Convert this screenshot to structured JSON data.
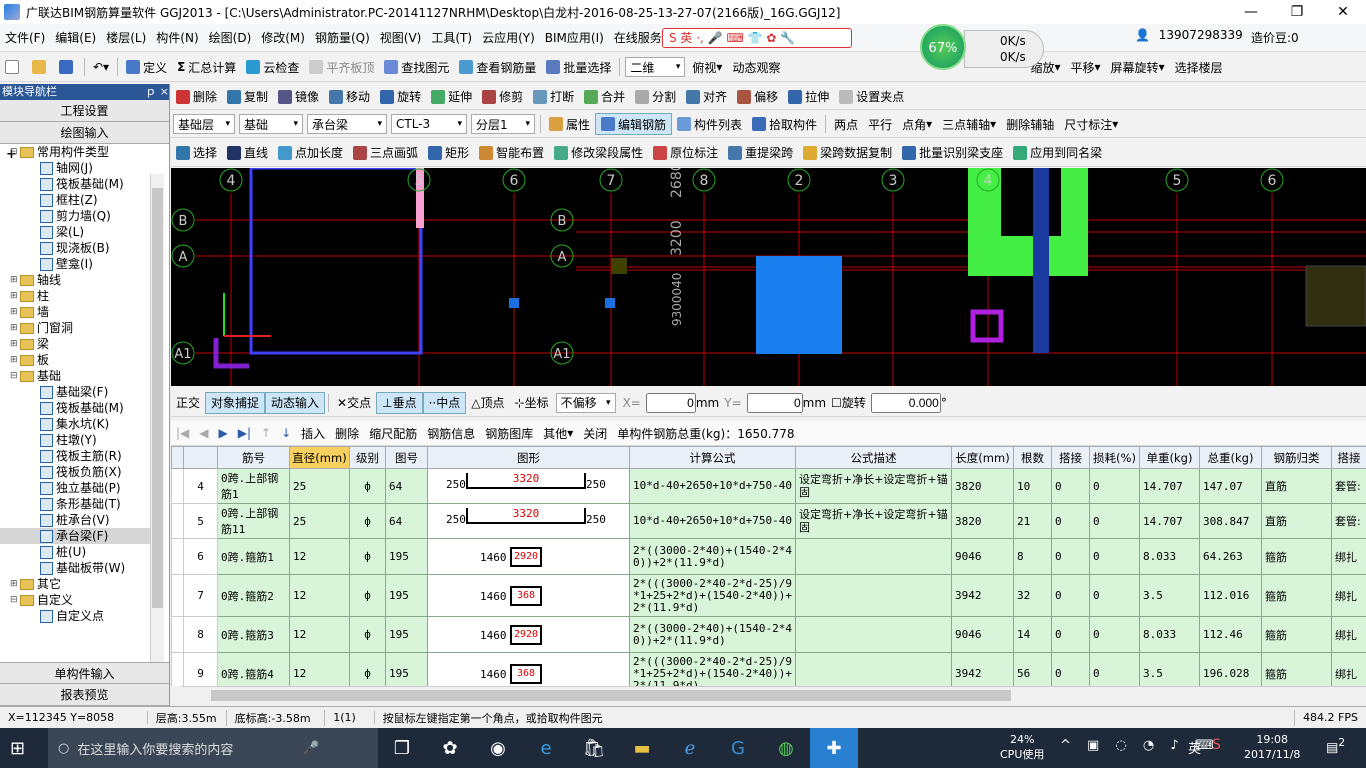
{
  "window": {
    "title": "广联达BIM钢筋算量软件 GGJ2013 - [C:\\Users\\Administrator.PC-20141127NRHM\\Desktop\\白龙村-2016-08-25-13-27-07(2166版)_16G.GGJ12]"
  },
  "menu": [
    "文件(F)",
    "编辑(E)",
    "楼层(L)",
    "构件(N)",
    "绘图(D)",
    "修改(M)",
    "钢筋量(Q)",
    "视图(V)",
    "工具(T)",
    "云应用(Y)",
    "BIM应用(I)",
    "在线服务(S)"
  ],
  "menu_right": {
    "phone": "13907298339",
    "coins": "造价豆:0"
  },
  "net_widget": {
    "percent": "67%",
    "up": "0K/s",
    "down": "0K/s"
  },
  "toolbar1": [
    "定义",
    "汇总计算",
    "云检查",
    "平齐板顶",
    "查找图元",
    "查看钢筋量",
    "批量选择"
  ],
  "toolbar1_right": [
    "二维",
    "俯视",
    "动态观察",
    "缩放",
    "平移",
    "屏幕旋转",
    "选择楼层"
  ],
  "toolbar2": [
    "删除",
    "复制",
    "镜像",
    "移动",
    "旋转",
    "延伸",
    "修剪",
    "打断",
    "合并",
    "分割",
    "对齐",
    "偏移",
    "拉伸",
    "设置夹点"
  ],
  "toolbar3": {
    "floor": "基础层",
    "cat": "基础",
    "type": "承台梁",
    "name": "CTL-3",
    "layer": "分层1",
    "buttons": [
      "属性",
      "编辑钢筋",
      "构件列表",
      "拾取构件",
      "两点",
      "平行",
      "点角",
      "三点辅轴",
      "删除辅轴",
      "尺寸标注"
    ]
  },
  "toolbar4": [
    "选择",
    "直线",
    "点加长度",
    "三点画弧",
    "矩形",
    "智能布置",
    "修改梁段属性",
    "原位标注",
    "重提梁跨",
    "梁跨数据复制",
    "批量识别梁支座",
    "应用到同名梁"
  ],
  "left_panel": {
    "header": "模块导航栏",
    "pin": "ｐ ×",
    "btn_project": "工程设置",
    "btn_draw": "绘图输入",
    "btn_single": "单构件输入",
    "btn_report": "报表预览"
  },
  "tree": [
    {
      "t": "常用构件类型",
      "lvl": 0,
      "ex": "⊟",
      "folder": true
    },
    {
      "t": "轴网(J)",
      "lvl": 2
    },
    {
      "t": "筏板基础(M)",
      "lvl": 2
    },
    {
      "t": "框柱(Z)",
      "lvl": 2
    },
    {
      "t": "剪力墙(Q)",
      "lvl": 2
    },
    {
      "t": "梁(L)",
      "lvl": 2
    },
    {
      "t": "现浇板(B)",
      "lvl": 2
    },
    {
      "t": "壁龛(I)",
      "lvl": 2
    },
    {
      "t": "轴线",
      "lvl": 0,
      "ex": "⊞",
      "folder": true
    },
    {
      "t": "柱",
      "lvl": 0,
      "ex": "⊞",
      "folder": true
    },
    {
      "t": "墙",
      "lvl": 0,
      "ex": "⊞",
      "folder": true
    },
    {
      "t": "门窗洞",
      "lvl": 0,
      "ex": "⊞",
      "folder": true
    },
    {
      "t": "梁",
      "lvl": 0,
      "ex": "⊞",
      "folder": true
    },
    {
      "t": "板",
      "lvl": 0,
      "ex": "⊞",
      "folder": true
    },
    {
      "t": "基础",
      "lvl": 0,
      "ex": "⊟",
      "folder": true
    },
    {
      "t": "基础梁(F)",
      "lvl": 2
    },
    {
      "t": "筏板基础(M)",
      "lvl": 2
    },
    {
      "t": "集水坑(K)",
      "lvl": 2
    },
    {
      "t": "柱墩(Y)",
      "lvl": 2
    },
    {
      "t": "筏板主筋(R)",
      "lvl": 2
    },
    {
      "t": "筏板负筋(X)",
      "lvl": 2
    },
    {
      "t": "独立基础(P)",
      "lvl": 2
    },
    {
      "t": "条形基础(T)",
      "lvl": 2
    },
    {
      "t": "桩承台(V)",
      "lvl": 2
    },
    {
      "t": "承台梁(F)",
      "lvl": 2,
      "sel": true
    },
    {
      "t": "桩(U)",
      "lvl": 2
    },
    {
      "t": "基础板带(W)",
      "lvl": 2
    },
    {
      "t": "其它",
      "lvl": 0,
      "ex": "⊞",
      "folder": true
    },
    {
      "t": "自定义",
      "lvl": 0,
      "ex": "⊟",
      "folder": true
    },
    {
      "t": "自定义点",
      "lvl": 2
    }
  ],
  "axis_labels_top": [
    "4",
    "5",
    "6",
    "7",
    "8",
    "2",
    "3",
    "4",
    "5",
    "6"
  ],
  "axis_labels_left": [
    "B",
    "A",
    "A1"
  ],
  "axis_labels_mid": [
    "B",
    "A",
    "A1"
  ],
  "canvas_texts": {
    "dim1": "2680",
    "dim2": "3200",
    "dim3": "9300040"
  },
  "snapbar": {
    "items": [
      "正交",
      "对象捕捉",
      "动态输入",
      "交点",
      "垂点",
      "中点",
      "顶点",
      "坐标"
    ],
    "offset": "不偏移",
    "x_label": "X=",
    "x": "0",
    "mm1": "mm",
    "y_label": "Y=",
    "y": "0",
    "mm2": "mm",
    "rotate_label": "旋转",
    "rotate": "0.000",
    "deg": "°"
  },
  "grid_toolbar": {
    "items": [
      "插入",
      "删除",
      "缩尺配筋",
      "钢筋信息",
      "钢筋图库",
      "其他",
      "关闭"
    ],
    "total": "单构件钢筋总重(kg)：1650.778"
  },
  "table": {
    "headers": [
      "筋号",
      "直径(mm)",
      "级别",
      "图号",
      "图形",
      "计算公式",
      "公式描述",
      "长度(mm)",
      "根数",
      "搭接",
      "损耗(%)",
      "单重(kg)",
      "总重(kg)",
      "钢筋归类",
      "搭接"
    ],
    "rows": [
      {
        "n": "4",
        "name": "0跨.上部钢筋1",
        "d": "25",
        "g": "ф",
        "fig": "64",
        "shape": {
          "l": "250",
          "m": "3320",
          "r": "250"
        },
        "formula": "10*d-40+2650+10*d+750-40",
        "desc": "设定弯折+净长+设定弯折+锚固",
        "len": "3820",
        "cnt": "10",
        "lap": "0",
        "loss": "0",
        "uw": "14.707",
        "tw": "147.07",
        "cls": "直筋",
        "lt": "套管:"
      },
      {
        "n": "5",
        "name": "0跨.上部钢筋11",
        "d": "25",
        "g": "ф",
        "fig": "64",
        "shape": {
          "l": "250",
          "m": "3320",
          "r": "250"
        },
        "formula": "10*d-40+2650+10*d+750-40",
        "desc": "设定弯折+净长+设定弯折+锚固",
        "len": "3820",
        "cnt": "21",
        "lap": "0",
        "loss": "0",
        "uw": "14.707",
        "tw": "308.847",
        "cls": "直筋",
        "lt": "套管:"
      },
      {
        "n": "6",
        "name": "0跨.箍筋1",
        "d": "12",
        "g": "ф",
        "fig": "195",
        "shape": {
          "a": "1460",
          "b": "2920"
        },
        "formula": "2*((3000-2*40)+(1540-2*40))+2*(11.9*d)",
        "desc": "",
        "len": "9046",
        "cnt": "8",
        "lap": "0",
        "loss": "0",
        "uw": "8.033",
        "tw": "64.263",
        "cls": "箍筋",
        "lt": "绑扎"
      },
      {
        "n": "7",
        "name": "0跨.箍筋2",
        "d": "12",
        "g": "ф",
        "fig": "195",
        "shape": {
          "a": "1460",
          "b": "368"
        },
        "formula": "2*(((3000-2*40-2*d-25)/9*1+25+2*d)+(1540-2*40))+2*(11.9*d)",
        "desc": "",
        "len": "3942",
        "cnt": "32",
        "lap": "0",
        "loss": "0",
        "uw": "3.5",
        "tw": "112.016",
        "cls": "箍筋",
        "lt": "绑扎"
      },
      {
        "n": "8",
        "name": "0跨.箍筋3",
        "d": "12",
        "g": "ф",
        "fig": "195",
        "shape": {
          "a": "1460",
          "b": "2920"
        },
        "formula": "2*((3000-2*40)+(1540-2*40))+2*(11.9*d)",
        "desc": "",
        "len": "9046",
        "cnt": "14",
        "lap": "0",
        "loss": "0",
        "uw": "8.033",
        "tw": "112.46",
        "cls": "箍筋",
        "lt": "绑扎"
      },
      {
        "n": "9",
        "name": "0跨.箍筋4",
        "d": "12",
        "g": "ф",
        "fig": "195",
        "shape": {
          "a": "1460",
          "b": "368"
        },
        "formula": "2*(((3000-2*40-2*d-25)/9*1+25+2*d)+(1540-2*40))+2*(11.9*d)",
        "desc": "",
        "len": "3942",
        "cnt": "56",
        "lap": "0",
        "loss": "0",
        "uw": "3.5",
        "tw": "196.028",
        "cls": "箍筋",
        "lt": "绑扎"
      }
    ]
  },
  "status": [
    "X=112345 Y=8058",
    "层高:3.55m",
    "底标高:-3.58m",
    "1(1)",
    "按鼠标左键指定第一个角点，或拾取构件图元",
    "484.2 FPS"
  ],
  "taskbar": {
    "search": "在这里输入你要搜索的内容",
    "cpu": "24%",
    "cpu_label": "CPU使用",
    "ime": "英",
    "time": "19:08",
    "date": "2017/11/8",
    "notif": "2"
  },
  "colors": {
    "canvas_bg": "#000000",
    "axis_red": "#c00000",
    "grid_bg": "#d9f5d9",
    "header_blue": "#2b5797"
  }
}
